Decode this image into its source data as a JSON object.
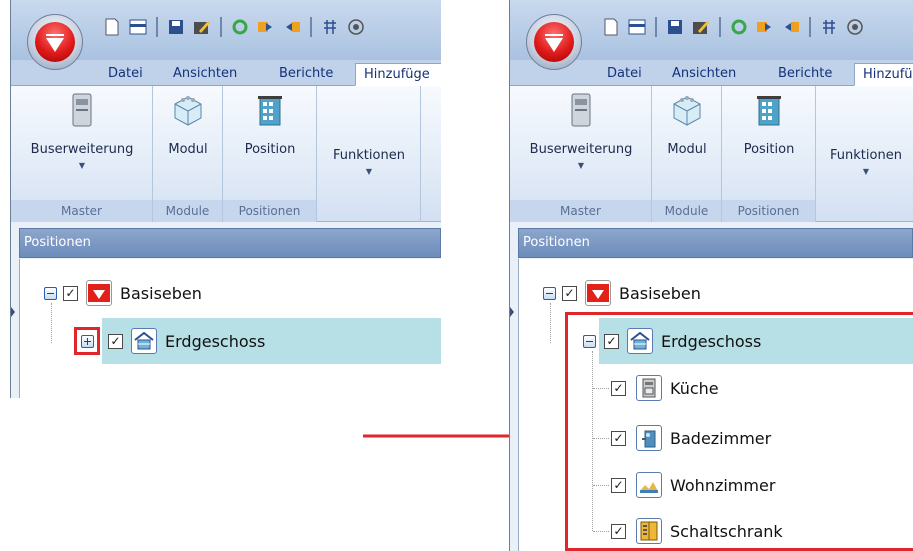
{
  "ribbon": {
    "tabs": [
      "Datei",
      "Ansichten",
      "Berichte"
    ],
    "active_tab_left": "Hinzufüge",
    "active_tab_right": "Hinzufü",
    "buttons": {
      "buserweiterung": "Buserweiterung",
      "modul": "Modul",
      "position": "Position",
      "funktionen": "Funktionen"
    },
    "groups": {
      "master": "Master",
      "module": "Module",
      "positionen": "Positionen"
    }
  },
  "pane": {
    "title": "Positionen"
  },
  "tree": {
    "root": "Basiseben",
    "floor": "Erdgeschoss",
    "rooms": [
      "Küche",
      "Badezimmer",
      "Wohnzimmer",
      "Schaltschrank"
    ]
  },
  "colors": {
    "highlight_box": "#e0252b",
    "selected_row": "#b6dfe6"
  }
}
